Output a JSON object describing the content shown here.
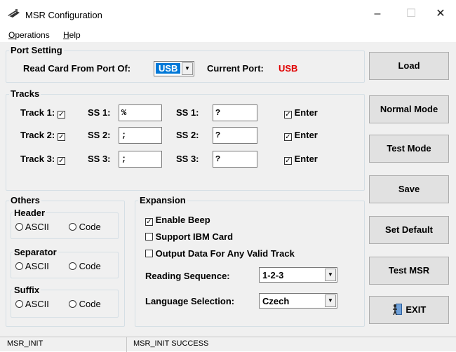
{
  "window": {
    "title": "MSR Configuration",
    "minimize": "–",
    "maximize": "☐",
    "close": "✕"
  },
  "menu": {
    "operations_prefix": "O",
    "operations_rest": "perations",
    "help_prefix": "H",
    "help_rest": "elp"
  },
  "port_setting": {
    "legend": "Port Setting",
    "read_label": "Read Card From Port Of:",
    "port_value": "USB",
    "current_label": "Current Port:",
    "current_value": "USB"
  },
  "tracks": {
    "legend": "Tracks",
    "rows": [
      {
        "track_label": "Track 1:",
        "check": "☑",
        "ss_a_label": "SS 1:",
        "ss_a_value": "%",
        "ss_b_label": "SS 1:",
        "ss_b_value": "?",
        "enter_label": "Enter"
      },
      {
        "track_label": "Track 2:",
        "check": "☑",
        "ss_a_label": "SS 2:",
        "ss_a_value": ";",
        "ss_b_label": "SS 2:",
        "ss_b_value": "?",
        "enter_label": "Enter"
      },
      {
        "track_label": "Track 3:",
        "check": "☑",
        "ss_a_label": "SS 3:",
        "ss_a_value": ";",
        "ss_b_label": "SS 3:",
        "ss_b_value": "?",
        "enter_label": "Enter"
      }
    ]
  },
  "others": {
    "legend": "Others",
    "groups": [
      {
        "legend": "Header",
        "opt_a": "ASCII",
        "opt_b": "Code"
      },
      {
        "legend": "Separator",
        "opt_a": "ASCII",
        "opt_b": "Code"
      },
      {
        "legend": "Suffix",
        "opt_a": "ASCII",
        "opt_b": "Code"
      }
    ]
  },
  "expansion": {
    "legend": "Expansion",
    "enable_beep": "Enable Beep",
    "support_ibm": "Support IBM  Card",
    "output_any": "Output Data For Any Valid Track",
    "reading_label": "Reading Sequence:",
    "reading_value": "1-2-3",
    "language_label": "Language Selection:",
    "language_value": "Czech"
  },
  "buttons": {
    "load": "Load",
    "normal": "Normal Mode",
    "test": "Test Mode",
    "save": "Save",
    "set_default": "Set Default",
    "test_msr": "Test MSR",
    "exit": "EXIT"
  },
  "status": {
    "left": "MSR_INIT",
    "right": "MSR_INIT SUCCESS"
  },
  "colors": {
    "current_port": "#e00000",
    "selection": "#0078d7"
  }
}
